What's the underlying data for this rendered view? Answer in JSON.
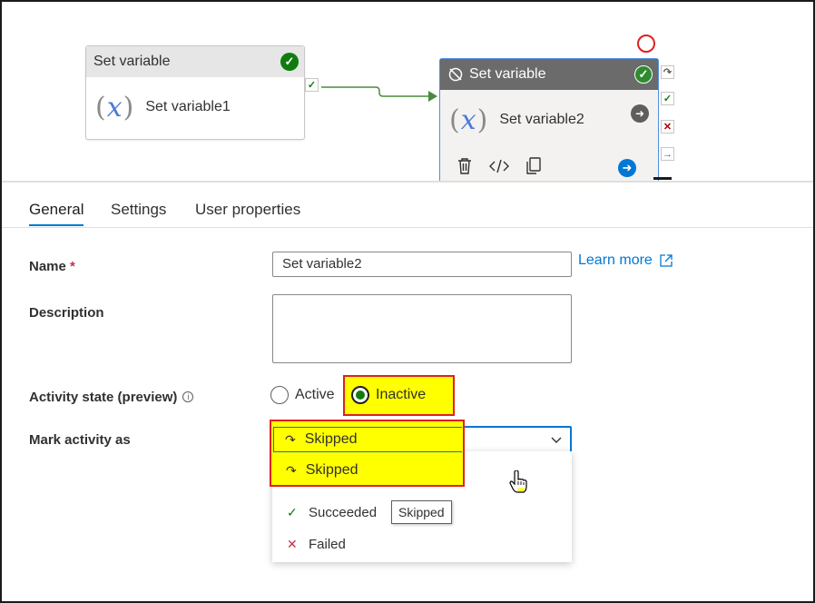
{
  "canvas": {
    "node1": {
      "header": "Set variable",
      "name": "Set variable1",
      "fx_symbol": "x",
      "status_icon": "check-circle-icon"
    },
    "node2": {
      "header": "Set variable",
      "name": "Set variable2",
      "fx_symbol": "x",
      "status_icon": "check-circle-icon",
      "deactivated_icon": "deactivated-icon",
      "tools": [
        "delete-icon",
        "code-icon",
        "copy-icon"
      ]
    },
    "ports": [
      "skip-port-icon",
      "success-port-icon",
      "fail-port-icon",
      "complete-port-icon"
    ]
  },
  "tabs": [
    {
      "label": "General",
      "active": true
    },
    {
      "label": "Settings",
      "active": false
    },
    {
      "label": "User properties",
      "active": false
    }
  ],
  "form": {
    "name_label": "Name",
    "required_mark": "*",
    "name_value": "Set variable2",
    "learn_more": "Learn more",
    "description_label": "Description",
    "description_value": "",
    "activity_state_label": "Activity state (preview)",
    "activity_state_options": [
      "Active",
      "Inactive"
    ],
    "activity_state_selected": "Inactive",
    "mark_activity_label": "Mark activity as",
    "mark_activity_value": "Skipped",
    "mark_activity_options": [
      "Skipped",
      "Succeeded",
      "Failed"
    ],
    "tooltip": "Skipped"
  },
  "colors": {
    "accent": "#0078d4",
    "success": "#107c10",
    "error": "#a80000",
    "highlight": "#ffff00",
    "annotation_border": "#e02020"
  }
}
